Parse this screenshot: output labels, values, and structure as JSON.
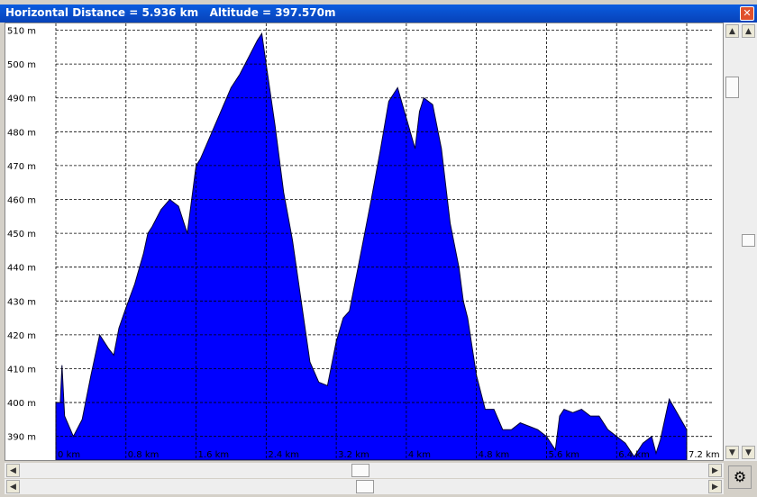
{
  "window": {
    "title": "Horizontal Distance = 5.936 km   Altitude = 397.570m",
    "close_glyph": "✕"
  },
  "icons": {
    "scroll_up": "▲",
    "scroll_down": "▼",
    "scroll_left": "◀",
    "scroll_right": "▶",
    "corner": "⚙"
  },
  "chart_data": {
    "type": "area",
    "color": "#0000ff",
    "grid": true,
    "xlim": [
      0,
      7.2
    ],
    "ylim": [
      383,
      512
    ],
    "y_ticks": [
      {
        "value": 390,
        "label": "390 m"
      },
      {
        "value": 400,
        "label": "400 m"
      },
      {
        "value": 410,
        "label": "410 m"
      },
      {
        "value": 420,
        "label": "420 m"
      },
      {
        "value": 430,
        "label": "430 m"
      },
      {
        "value": 440,
        "label": "440 m"
      },
      {
        "value": 450,
        "label": "450 m"
      },
      {
        "value": 460,
        "label": "460 m"
      },
      {
        "value": 470,
        "label": "470 m"
      },
      {
        "value": 480,
        "label": "480 m"
      },
      {
        "value": 490,
        "label": "490 m"
      },
      {
        "value": 500,
        "label": "500 m"
      },
      {
        "value": 510,
        "label": "510 m"
      }
    ],
    "x_ticks": [
      {
        "value": 0,
        "label": "0 km"
      },
      {
        "value": 0.8,
        "label": "0.8 km"
      },
      {
        "value": 1.6,
        "label": "1.6 km"
      },
      {
        "value": 2.4,
        "label": "2.4 km"
      },
      {
        "value": 3.2,
        "label": "3.2 km"
      },
      {
        "value": 4.0,
        "label": "4 km"
      },
      {
        "value": 4.8,
        "label": "4.8 km"
      },
      {
        "value": 5.6,
        "label": "5.6 km"
      },
      {
        "value": 6.4,
        "label": "6.4 km"
      },
      {
        "value": 7.2,
        "label": "7.2 km"
      }
    ],
    "x": [
      0,
      0.05,
      0.07,
      0.1,
      0.2,
      0.3,
      0.4,
      0.5,
      0.6,
      0.66,
      0.72,
      0.8,
      0.9,
      1.0,
      1.05,
      1.1,
      1.2,
      1.3,
      1.4,
      1.5,
      1.6,
      1.65,
      1.7,
      1.8,
      1.9,
      2.0,
      2.1,
      2.2,
      2.3,
      2.35,
      2.4,
      2.5,
      2.6,
      2.7,
      2.8,
      2.9,
      3.0,
      3.1,
      3.2,
      3.28,
      3.35,
      3.45,
      3.6,
      3.7,
      3.8,
      3.9,
      4.0,
      4.1,
      4.15,
      4.2,
      4.3,
      4.4,
      4.5,
      4.6,
      4.65,
      4.7,
      4.8,
      4.9,
      5.0,
      5.1,
      5.2,
      5.3,
      5.4,
      5.5,
      5.6,
      5.7,
      5.75,
      5.8,
      5.9,
      6.0,
      6.1,
      6.2,
      6.3,
      6.4,
      6.5,
      6.6,
      6.7,
      6.8,
      6.85,
      6.9,
      7.0,
      7.2
    ],
    "values": [
      400,
      400,
      411,
      396,
      390,
      395,
      408,
      420,
      416,
      414,
      422,
      428,
      435,
      444,
      450,
      452,
      457,
      460,
      458,
      450,
      470,
      472,
      475,
      481,
      487,
      493,
      497,
      502,
      507,
      509,
      500,
      482,
      462,
      448,
      430,
      412,
      406,
      405,
      418,
      425,
      427,
      440,
      460,
      474,
      489,
      493,
      484,
      475,
      486,
      490,
      488,
      475,
      453,
      440,
      430,
      425,
      408,
      398,
      398,
      392,
      392,
      394,
      393,
      392,
      390,
      386,
      396,
      398,
      397,
      398,
      396,
      396,
      392,
      390,
      388,
      384,
      388,
      390,
      385,
      389,
      401,
      392
    ]
  }
}
